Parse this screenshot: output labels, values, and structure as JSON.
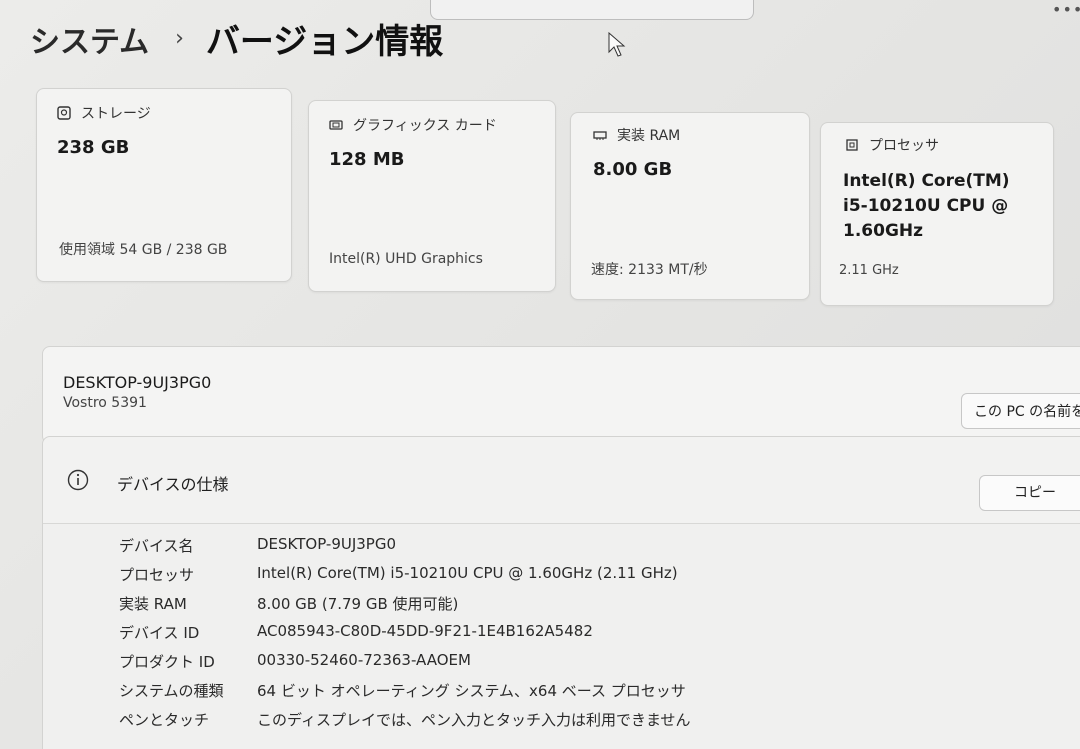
{
  "header": {
    "breadcrumb_parent": "システム",
    "breadcrumb_separator": "›",
    "page_title": "バージョン情報"
  },
  "cards": [
    {
      "label": "ストレージ",
      "icon": "storage-icon",
      "value": "238 GB",
      "sub": "使用領域 54 GB / 238 GB"
    },
    {
      "label": "グラフィックス カード",
      "icon": "graphics-card-icon",
      "value": "128 MB",
      "sub": "Intel(R) UHD Graphics"
    },
    {
      "label": "実装 RAM",
      "icon": "ram-icon",
      "value": "8.00 GB",
      "sub": "速度: 2133 MT/秒"
    },
    {
      "label": "プロセッサ",
      "icon": "processor-icon",
      "value_lines": [
        "Intel(R) Core(TM)",
        "i5-10210U CPU @",
        "1.60GHz"
      ],
      "sub": "2.11 GHz"
    }
  ],
  "device": {
    "name": "DESKTOP-9UJ3PG0",
    "model": "Vostro 5391",
    "rename_label": "この PC の名前を変"
  },
  "specs": {
    "title": "デバイスの仕様",
    "copy_label": "コピー",
    "rows": [
      {
        "key": "デバイス名",
        "value": "DESKTOP-9UJ3PG0"
      },
      {
        "key": "プロセッサ",
        "value": "Intel(R) Core(TM) i5-10210U CPU @ 1.60GHz (2.11 GHz)"
      },
      {
        "key": "実装 RAM",
        "value": "8.00 GB (7.79 GB 使用可能)"
      },
      {
        "key": "デバイス ID",
        "value": "AC085943-C80D-45DD-9F21-1E4B162A5482"
      },
      {
        "key": "プロダクト ID",
        "value": "00330-52460-72363-AAOEM"
      },
      {
        "key": "システムの種類",
        "value": "64 ビット オペレーティング システム、x64 ベース プロセッサ"
      },
      {
        "key": "ペンとタッチ",
        "value": "このディスプレイでは、ペン入力とタッチ入力は利用できません"
      }
    ]
  }
}
